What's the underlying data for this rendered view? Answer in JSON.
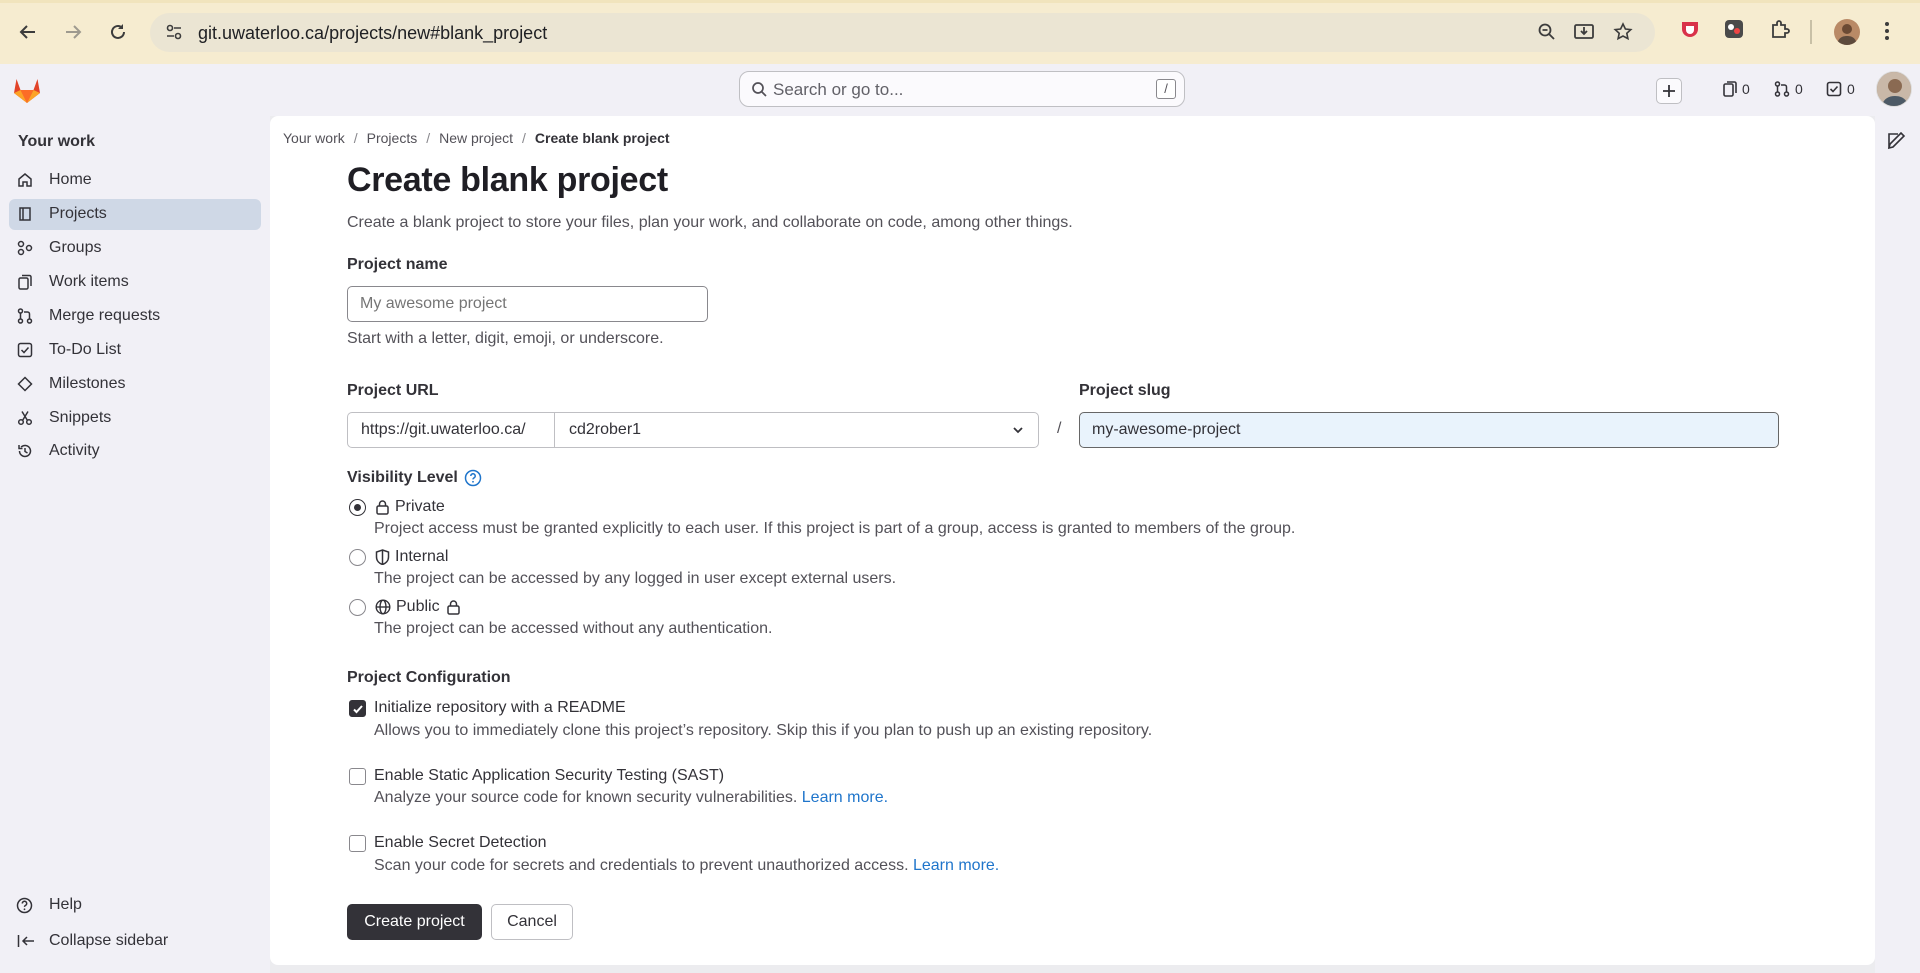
{
  "browser": {
    "url": "git.uwaterloo.ca/projects/new#blank_project"
  },
  "topbar": {
    "search_placeholder": "Search or go to...",
    "search_shortcut": "/",
    "issues_count": "0",
    "merge_requests_count": "0",
    "todos_count": "0"
  },
  "sidebar": {
    "title": "Your work",
    "items": [
      {
        "label": "Home",
        "icon": "home-icon"
      },
      {
        "label": "Projects",
        "icon": "project-icon",
        "active": true
      },
      {
        "label": "Groups",
        "icon": "group-icon"
      },
      {
        "label": "Work items",
        "icon": "work-items-icon"
      },
      {
        "label": "Merge requests",
        "icon": "merge-request-icon"
      },
      {
        "label": "To-Do List",
        "icon": "todo-icon"
      },
      {
        "label": "Milestones",
        "icon": "milestone-icon"
      },
      {
        "label": "Snippets",
        "icon": "snippet-icon"
      },
      {
        "label": "Activity",
        "icon": "history-icon"
      }
    ],
    "help": "Help",
    "collapse": "Collapse sidebar"
  },
  "breadcrumb": [
    "Your work",
    "Projects",
    "New project",
    "Create blank project"
  ],
  "page": {
    "title": "Create blank project",
    "lead": "Create a blank project to store your files, plan your work, and collaborate on code, among other things."
  },
  "form": {
    "project_name_label": "Project name",
    "project_name_placeholder": "My awesome project",
    "project_name_help": "Start with a letter, digit, emoji, or underscore.",
    "project_url_label": "Project URL",
    "url_prefix": "https://git.uwaterloo.ca/",
    "namespace": "cd2rober1",
    "slash": "/",
    "project_slug_label": "Project slug",
    "project_slug_value": "my-awesome-project",
    "visibility_label": "Visibility Level",
    "visibility": [
      {
        "label": "Private",
        "desc": "Project access must be granted explicitly to each user. If this project is part of a group, access is granted to members of the group.",
        "checked": true
      },
      {
        "label": "Internal",
        "desc": "The project can be accessed by any logged in user except external users."
      },
      {
        "label": "Public",
        "desc": "The project can be accessed without any authentication."
      }
    ],
    "config_label": "Project Configuration",
    "config": [
      {
        "label": "Initialize repository with a README",
        "desc": "Allows you to immediately clone this project’s repository. Skip this if you plan to push up an existing repository.",
        "checked": true
      },
      {
        "label": "Enable Static Application Security Testing (SAST)",
        "desc": "Analyze your source code for known security vulnerabilities.",
        "link": "Learn more."
      },
      {
        "label": "Enable Secret Detection",
        "desc": "Scan your code for secrets and credentials to prevent unauthorized access.",
        "link": "Learn more."
      }
    ],
    "create_button": "Create project",
    "cancel_button": "Cancel"
  }
}
